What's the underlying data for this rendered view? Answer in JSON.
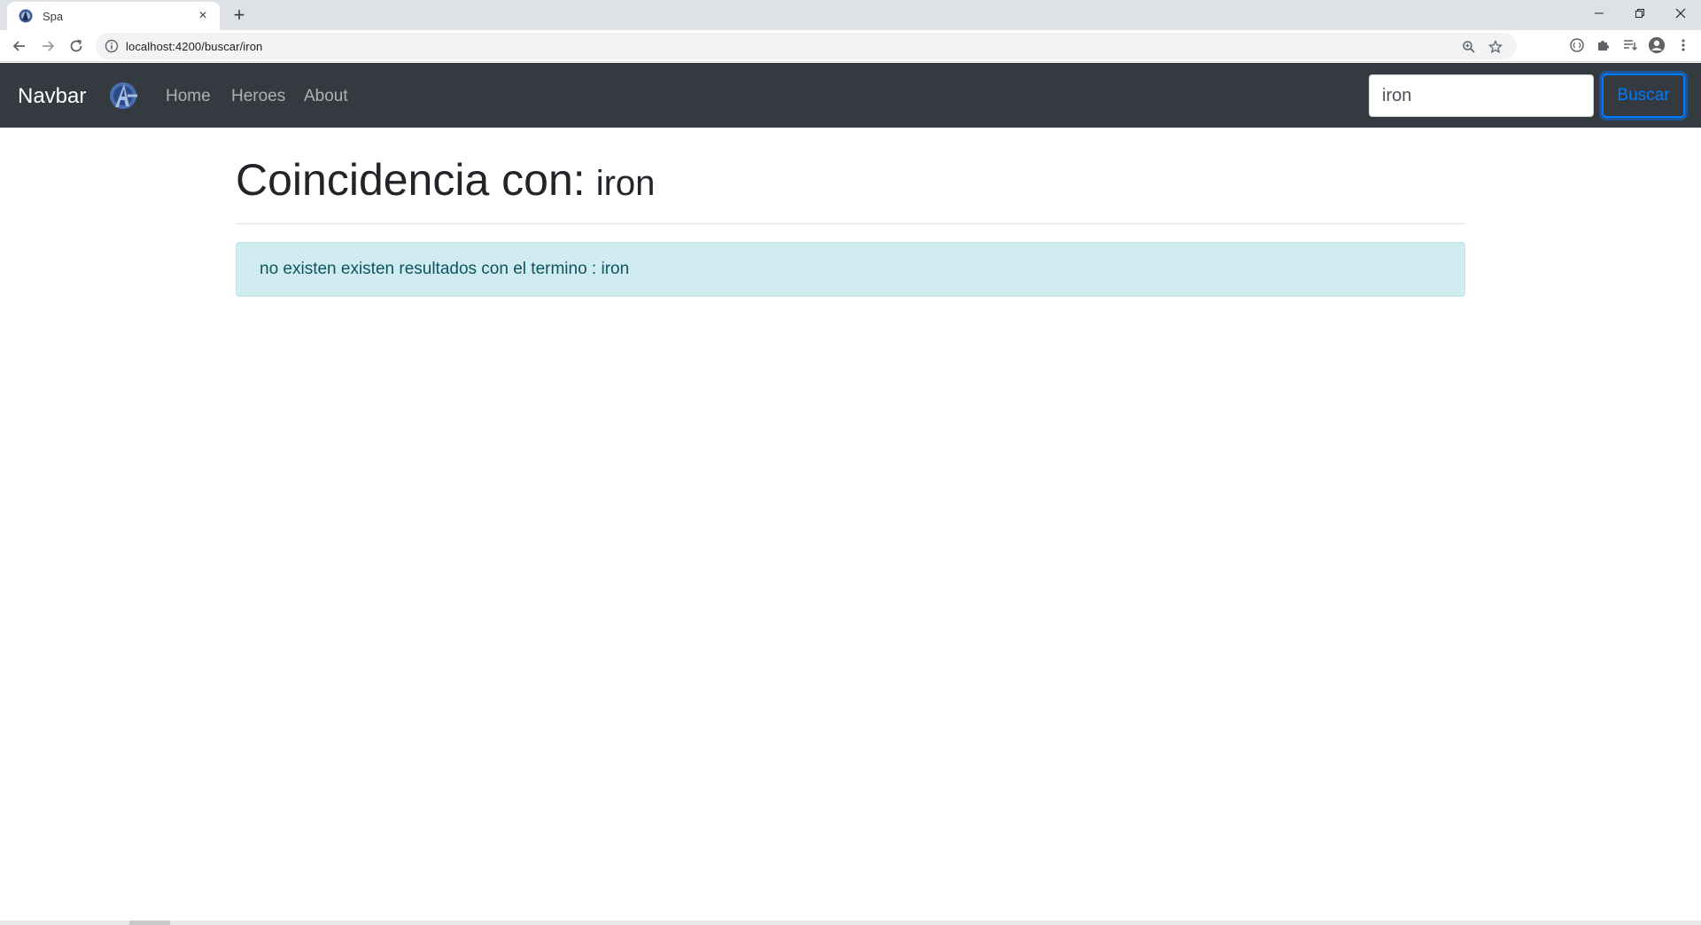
{
  "browser": {
    "tab_title": "Spa",
    "new_tab_symbol": "+",
    "close_symbol": "×",
    "url": "localhost:4200/buscar/iron",
    "icons": [
      "back-icon",
      "forward-icon",
      "reload-icon",
      "info-icon",
      "zoom-icon",
      "star-icon",
      "extension-icon",
      "puzzle-icon",
      "reading-list-icon",
      "profile-icon",
      "menu-icon"
    ]
  },
  "navbar": {
    "brand": "Navbar",
    "links": [
      "Home",
      "Heroes",
      "About"
    ],
    "search_value": "iron",
    "search_button": "Buscar",
    "colors": {
      "background": "#343a40",
      "button": "#007bff"
    }
  },
  "main": {
    "heading_label": "Coincidencia con:",
    "heading_term": "iron",
    "alert_text": "no existen existen resultados con el termino : iron",
    "colors": {
      "alert_bg": "#d1ecf1",
      "alert_text": "#0c5460"
    }
  }
}
